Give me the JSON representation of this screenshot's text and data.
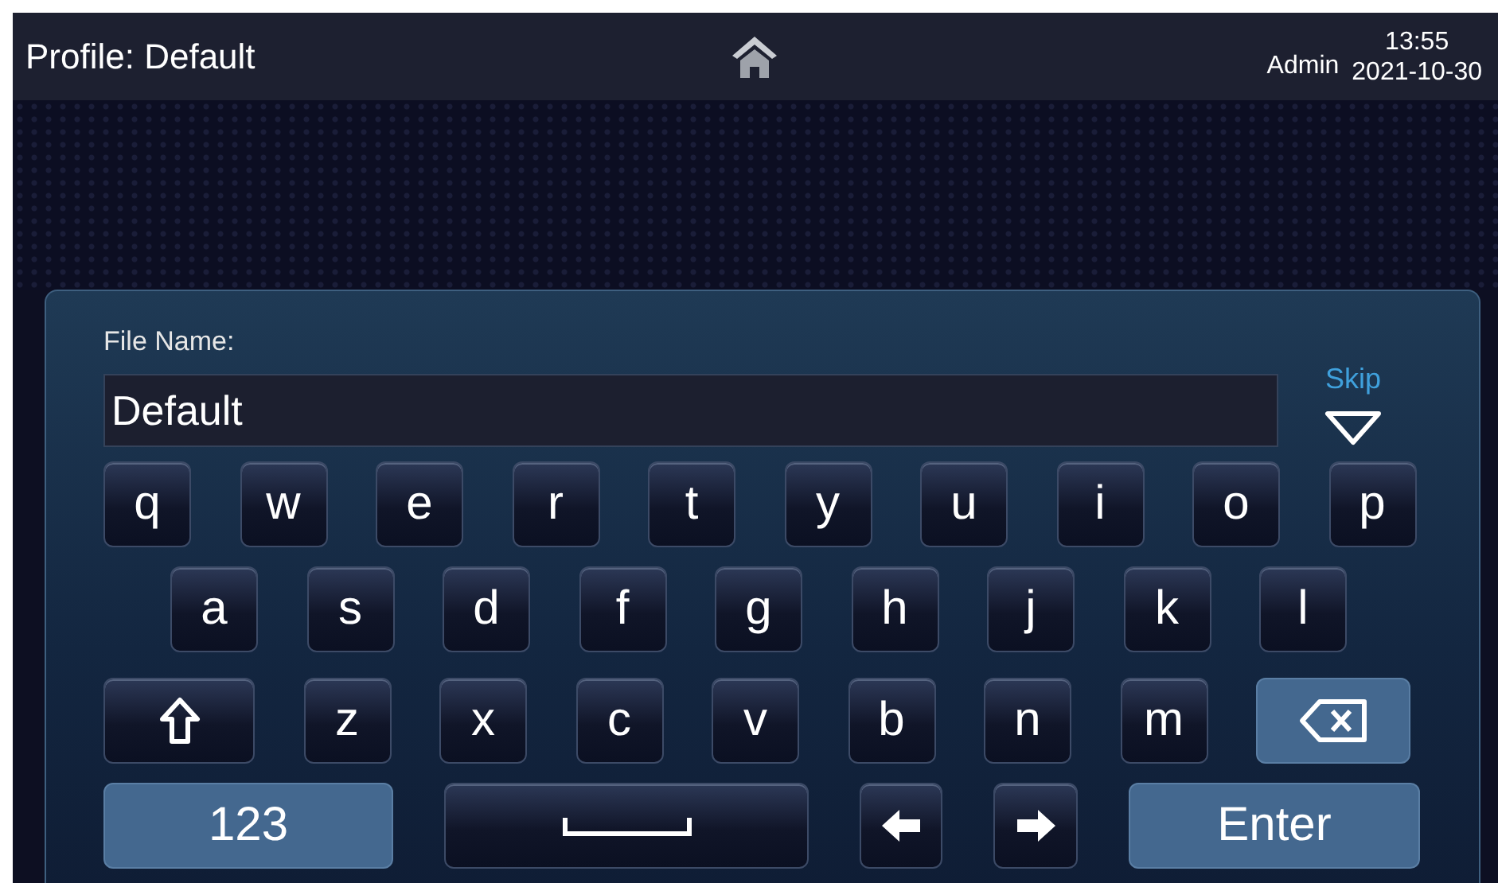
{
  "top_bar": {
    "title": "Profile: Default",
    "user": "Admin",
    "time": "13:55",
    "date": "2021-10-30"
  },
  "dialog": {
    "field_label": "File Name:",
    "field_value": "Default",
    "skip": "Skip"
  },
  "keyboard": {
    "rows": [
      {
        "keys": [
          {
            "kind": "letter",
            "label": "q"
          },
          {
            "kind": "letter",
            "label": "w"
          },
          {
            "kind": "letter",
            "label": "e"
          },
          {
            "kind": "letter",
            "label": "r"
          },
          {
            "kind": "letter",
            "label": "t"
          },
          {
            "kind": "letter",
            "label": "y"
          },
          {
            "kind": "letter",
            "label": "u"
          },
          {
            "kind": "letter",
            "label": "i"
          },
          {
            "kind": "letter",
            "label": "o"
          },
          {
            "kind": "letter",
            "label": "p"
          }
        ]
      },
      {
        "keys": [
          {
            "kind": "letter",
            "label": "a"
          },
          {
            "kind": "letter",
            "label": "s"
          },
          {
            "kind": "letter",
            "label": "d"
          },
          {
            "kind": "letter",
            "label": "f"
          },
          {
            "kind": "letter",
            "label": "g"
          },
          {
            "kind": "letter",
            "label": "h"
          },
          {
            "kind": "letter",
            "label": "j"
          },
          {
            "kind": "letter",
            "label": "k"
          },
          {
            "kind": "letter",
            "label": "l"
          }
        ]
      },
      {
        "keys": [
          {
            "kind": "shift"
          },
          {
            "kind": "letter",
            "label": "z"
          },
          {
            "kind": "letter",
            "label": "x"
          },
          {
            "kind": "letter",
            "label": "c"
          },
          {
            "kind": "letter",
            "label": "v"
          },
          {
            "kind": "letter",
            "label": "b"
          },
          {
            "kind": "letter",
            "label": "n"
          },
          {
            "kind": "letter",
            "label": "m"
          },
          {
            "kind": "backspace"
          }
        ]
      },
      {
        "keys": [
          {
            "kind": "mode",
            "label": "123"
          },
          {
            "kind": "space"
          },
          {
            "kind": "left"
          },
          {
            "kind": "right"
          },
          {
            "kind": "enter",
            "label": "Enter"
          }
        ]
      }
    ]
  }
}
